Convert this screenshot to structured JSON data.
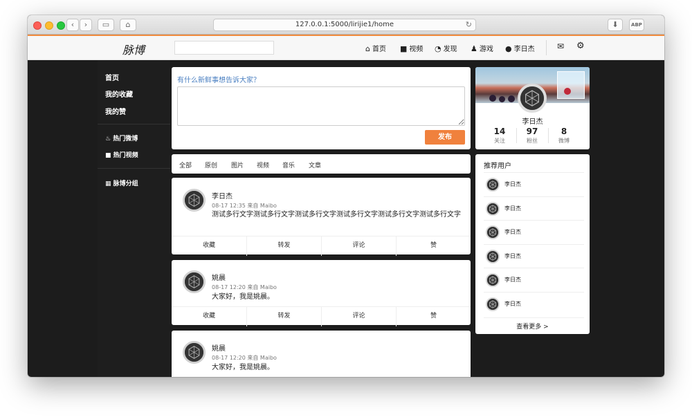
{
  "browser": {
    "url": "127.0.0.1:5000/lirijie1/home",
    "buttons": [
      "‹",
      "›",
      "▭",
      "⌂"
    ],
    "right_buttons": [
      "⬇",
      "ABP"
    ],
    "reload": "↻"
  },
  "nav": {
    "logo": "脉博",
    "search_placeholder": "",
    "items": [
      {
        "icon": "home-icon",
        "glyph": "⌂",
        "label": "首页"
      },
      {
        "icon": "video-icon",
        "glyph": "■",
        "label": "视频"
      },
      {
        "icon": "compass-icon",
        "glyph": "◔",
        "label": "发现"
      },
      {
        "icon": "game-icon",
        "glyph": "♟",
        "label": "游戏"
      },
      {
        "icon": "user-icon",
        "glyph": "●",
        "label": "李日杰"
      }
    ],
    "mail_glyph": "✉",
    "settings_glyph": "⚙"
  },
  "sidebar": {
    "items": [
      {
        "label": "首页"
      },
      {
        "label": "我的收藏"
      },
      {
        "label": "我的赞"
      },
      {
        "label": "热门微博",
        "glyph": "♨"
      },
      {
        "label": "热门视频",
        "glyph": "■"
      },
      {
        "label": "脉博分组",
        "glyph": "▦"
      }
    ]
  },
  "compose": {
    "prompt": "有什么新鲜事想告诉大家？",
    "placeholder": "",
    "publish_label": "发布"
  },
  "filters": [
    "全部",
    "原创",
    "图片",
    "视频",
    "音乐",
    "文章"
  ],
  "posts": [
    {
      "author": "李日杰",
      "meta": "08-17 12:35 来自 Maibo",
      "text": "测试多行文字测试多行文字测试多行文字测试多行文字测试多行文字测试多行文字"
    },
    {
      "author": "姚晨",
      "meta": "08-17 12:20 来自 Maibo",
      "text": "大家好，我是姚晨。"
    },
    {
      "author": "姚晨",
      "meta": "08-17 12:20 来自 Maibo",
      "text": "大家好，我是姚晨。"
    }
  ],
  "post_actions": [
    "收藏",
    "转发",
    "评论",
    "赞"
  ],
  "profile": {
    "name": "李日杰",
    "stats": [
      {
        "value": "14",
        "label": "关注"
      },
      {
        "value": "97",
        "label": "粉丝"
      },
      {
        "value": "8",
        "label": "微博"
      }
    ]
  },
  "recommend": {
    "title": "推荐用户",
    "users": [
      "李日杰",
      "李日杰",
      "李日杰",
      "李日杰",
      "李日杰",
      "李日杰"
    ],
    "more": "查看更多 >"
  }
}
